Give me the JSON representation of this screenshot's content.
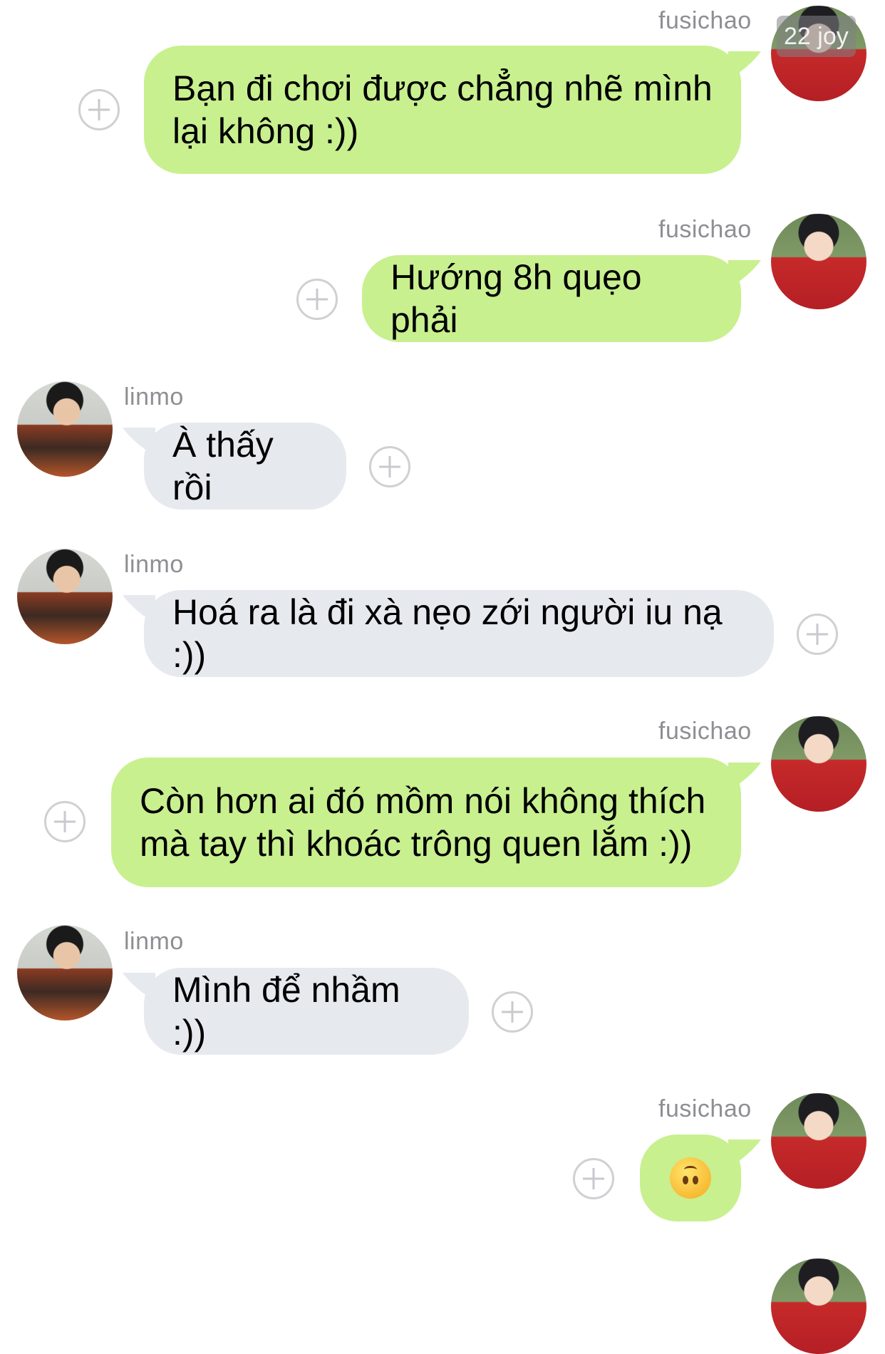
{
  "messages": [
    {
      "sender": "fusichao",
      "side": "right",
      "text": "Bạn đi chơi được chẳng nhẽ mình lại không :))"
    },
    {
      "sender": "fusichao",
      "side": "right",
      "text": "Hướng 8h quẹo phải"
    },
    {
      "sender": "linmo",
      "side": "left",
      "text": "À thấy rồi"
    },
    {
      "sender": "linmo",
      "side": "left",
      "text": "Hoá ra là đi xà nẹo zới người iu nạ :))"
    },
    {
      "sender": "fusichao",
      "side": "right",
      "text": "Còn hơn ai đó mồm nói không thích mà tay thì khoác trông quen lắm :))"
    },
    {
      "sender": "linmo",
      "side": "left",
      "text": "Mình để nhầm :))"
    },
    {
      "sender": "fusichao",
      "side": "right",
      "emoji": "upside-down-face"
    }
  ],
  "timestamp_badge": "22 joy",
  "colors": {
    "outgoing_bubble": "#c8f08f",
    "incoming_bubble": "#e6e9ee",
    "name_text": "#8e8e93"
  }
}
